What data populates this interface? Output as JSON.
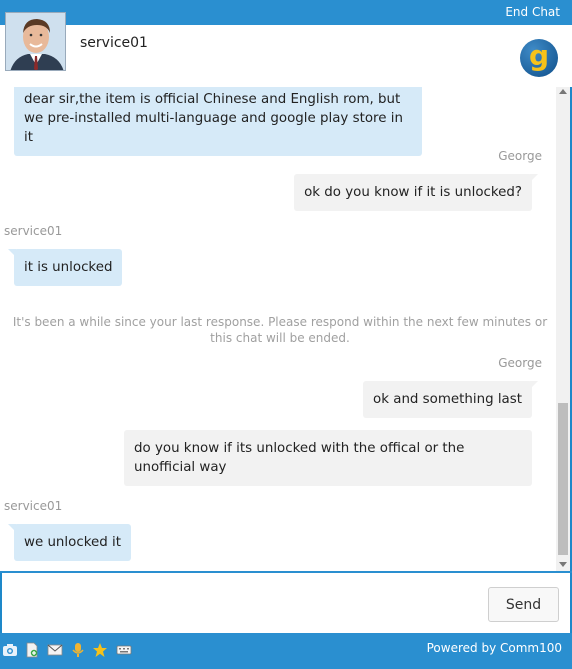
{
  "header": {
    "end_chat": "End Chat",
    "agent_name": "service01",
    "logo_letter": "g"
  },
  "messages": [
    {
      "type": "agent",
      "text": "dear sir,the item is official Chinese and English rom, but we pre-installed multi-language and google play store in it"
    },
    {
      "type": "sender",
      "text": "George"
    },
    {
      "type": "visitor",
      "text": "ok do you know if it is unlocked?"
    },
    {
      "type": "sender",
      "text": "service01"
    },
    {
      "type": "agent",
      "text": "it is unlocked"
    },
    {
      "type": "system",
      "text": "It's been a while since your last response. Please respond within the next few minutes or this chat will be ended."
    },
    {
      "type": "sender",
      "text": "George"
    },
    {
      "type": "visitor",
      "text": "ok and something last"
    },
    {
      "type": "visitor",
      "text": "do you know if its unlocked with the offical or the unofficial way"
    },
    {
      "type": "sender",
      "text": "service01"
    },
    {
      "type": "agent",
      "text": "we unlocked it"
    }
  ],
  "composer": {
    "placeholder": "",
    "send_label": "Send"
  },
  "toolbar": {
    "icons": [
      "camera-icon",
      "file-upload-icon",
      "email-icon",
      "microphone-icon",
      "star-icon",
      "keyboard-icon"
    ],
    "powered_by": "Powered by Comm100"
  },
  "colors": {
    "brand_blue": "#2a8fd0",
    "agent_bubble": "#d6eaf8",
    "visitor_bubble": "#f2f2f2"
  }
}
